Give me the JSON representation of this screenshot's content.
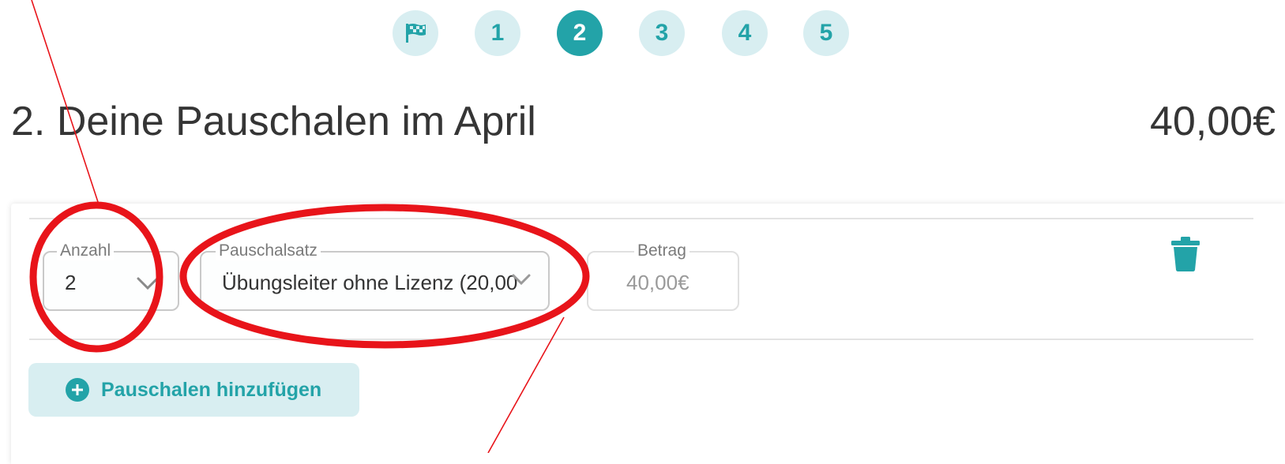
{
  "stepper": {
    "steps": [
      {
        "label": "",
        "icon": "flag-checkered-icon",
        "active": false
      },
      {
        "label": "1",
        "active": false
      },
      {
        "label": "2",
        "active": true
      },
      {
        "label": "3",
        "active": false
      },
      {
        "label": "4",
        "active": false
      },
      {
        "label": "5",
        "active": false
      }
    ]
  },
  "header": {
    "title": "2. Deine Pauschalen im April",
    "total": "40,00€"
  },
  "entry": {
    "anzahl": {
      "label": "Anzahl",
      "value": "2",
      "icon": "chevron-down-icon"
    },
    "pauschalsatz": {
      "label": "Pauschalsatz",
      "value": "Übungsleiter ohne Lizenz (20,00",
      "icon": "chevron-down-icon"
    },
    "betrag": {
      "label": "Betrag",
      "value": "40,00€"
    },
    "delete_icon": "trash-icon"
  },
  "add_button": {
    "label": "Pauschalen hinzufügen",
    "icon": "plus-circle-icon"
  },
  "colors": {
    "accent": "#23a3a8",
    "accent_light": "#d8eef1",
    "annotation": "#e8141a"
  }
}
